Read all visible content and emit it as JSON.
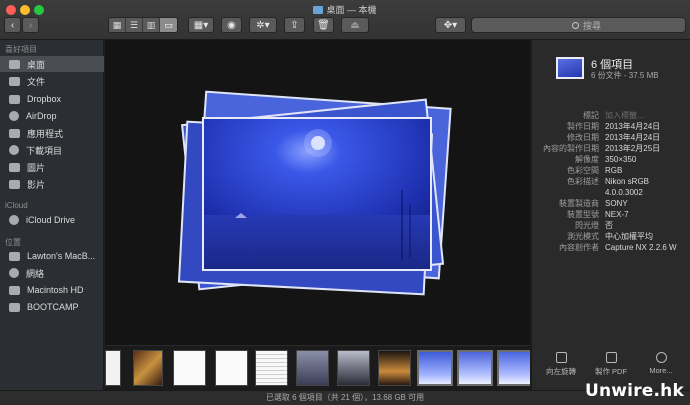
{
  "window": {
    "title": "桌面 — 本機",
    "traffic_colors": [
      "#ff5f57",
      "#febc2e",
      "#28c840"
    ]
  },
  "toolbar": {
    "back_icon": "chevron-left-icon",
    "forward_icon": "chevron-right-icon",
    "view_modes": [
      "icon-view-icon",
      "list-view-icon",
      "column-view-icon",
      "gallery-view-icon"
    ],
    "active_view": 3,
    "search_placeholder": "搜尋"
  },
  "sidebar": {
    "favorites_header": "喜好項目",
    "favorites": [
      {
        "label": "桌面",
        "icon": "desktop-icon",
        "selected": true
      },
      {
        "label": "文件",
        "icon": "documents-icon"
      },
      {
        "label": "Dropbox",
        "icon": "dropbox-icon"
      },
      {
        "label": "AirDrop",
        "icon": "airdrop-icon"
      },
      {
        "label": "應用程式",
        "icon": "applications-icon"
      },
      {
        "label": "下載項目",
        "icon": "downloads-icon"
      },
      {
        "label": "圖片",
        "icon": "pictures-icon"
      },
      {
        "label": "影片",
        "icon": "movies-icon"
      }
    ],
    "icloud_header": "iCloud",
    "icloud": [
      {
        "label": "iCloud Drive",
        "icon": "cloud-icon"
      }
    ],
    "locations_header": "位置",
    "locations": [
      {
        "label": "Lawton's MacB...",
        "icon": "laptop-icon"
      },
      {
        "label": "網絡",
        "icon": "network-icon"
      },
      {
        "label": "Macintosh HD",
        "icon": "disk-icon"
      },
      {
        "label": "BOOTCAMP",
        "icon": "disk-icon"
      }
    ]
  },
  "inspector": {
    "title": "6 個項目",
    "subtitle": "6 份文件 - 37.5 MB",
    "metadata": [
      {
        "key": "標記",
        "value": "加入標籤…",
        "dim": true
      },
      {
        "key": "製作日期",
        "value": "2013年4月24日"
      },
      {
        "key": "修改日期",
        "value": "2013年4月24日"
      },
      {
        "key": "內容的製作日期",
        "value": "2013年2月25日"
      },
      {
        "key": "解像度",
        "value": "350×350"
      },
      {
        "key": "色彩空間",
        "value": "RGB"
      },
      {
        "key": "色彩描述",
        "value": "Nikon sRGB"
      },
      {
        "key": "",
        "value": "4.0.0.3002"
      },
      {
        "key": "裝置製造商",
        "value": "SONY"
      },
      {
        "key": "裝置型號",
        "value": "NEX-7"
      },
      {
        "key": "閃光燈",
        "value": "否"
      },
      {
        "key": "測光模式",
        "value": "中心加權平均"
      },
      {
        "key": "內容創作者",
        "value": "Capture NX 2.2.6 W"
      }
    ],
    "actions": [
      {
        "label": "向左旋轉",
        "icon": "rotate-left-icon"
      },
      {
        "label": "製作 PDF",
        "icon": "pdf-icon"
      },
      {
        "label": "More...",
        "icon": "more-icon"
      }
    ]
  },
  "status": "已選取 6 個項目（共 21 個），13.68 GB 可用",
  "watermark": "Unwire.hk"
}
